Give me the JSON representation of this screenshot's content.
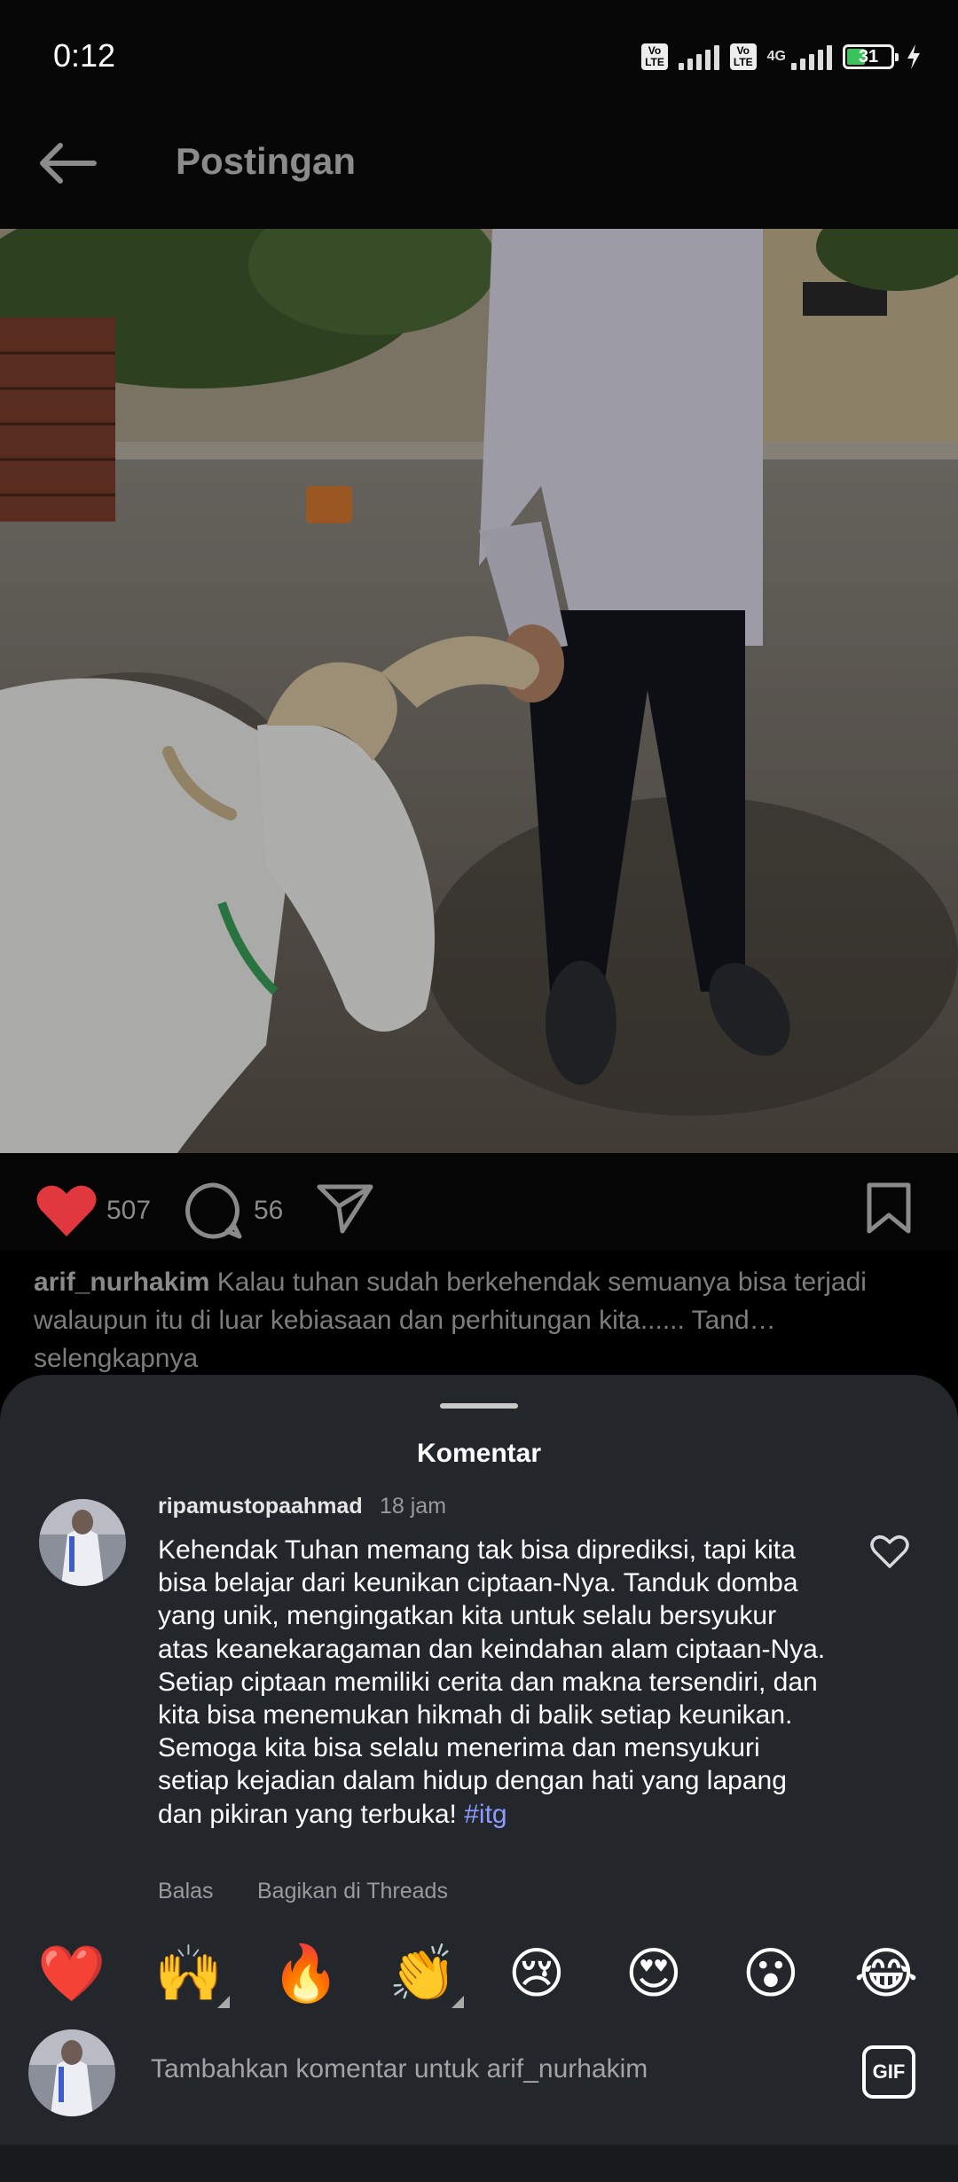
{
  "status_bar": {
    "time": "0:12",
    "volte1": "Vo LTE",
    "volte2": "Vo LTE",
    "network": "4G",
    "battery_level": "31"
  },
  "header": {
    "title": "Postingan"
  },
  "post": {
    "likes": "507",
    "comments": "56",
    "caption_user": "arif_nurhakim",
    "caption_text": "Kalau tuhan sudah berkehendak semuanya bisa terjadi walaupun itu di luar kebiasaan dan  perhitungan kita...... Tand…",
    "see_more": "selengkapnya"
  },
  "comments_sheet": {
    "title": "Komentar",
    "comment": {
      "username": "ripamustopaahmad",
      "time": "18 jam",
      "text": "Kehendak Tuhan memang tak bisa diprediksi, tapi kita bisa belajar dari keunikan ciptaan-Nya. Tanduk domba yang unik, mengingatkan kita untuk selalu bersyukur atas keanekaragaman dan keindahan alam ciptaan-Nya. Setiap ciptaan memiliki cerita dan makna tersendiri, dan kita bisa menemukan hikmah di balik setiap keunikan. Semoga kita bisa selalu menerima dan mensyukuri setiap kejadian dalam hidup dengan hati yang lapang dan pikiran yang terbuka!",
      "hashtag": "#itg",
      "reply_label": "Balas",
      "share_label": "Bagikan di Threads"
    },
    "quick_emojis": [
      "❤️",
      "🙌",
      "🔥",
      "👏",
      "😢",
      "😍",
      "😮",
      "😂"
    ],
    "input_placeholder": "Tambahkan komentar untuk arif_nurhakim",
    "gif_label": "GIF"
  },
  "colors": {
    "like_red": "#e0383e",
    "sheet_bg": "#23262b",
    "hashtag": "#8a9cff"
  }
}
